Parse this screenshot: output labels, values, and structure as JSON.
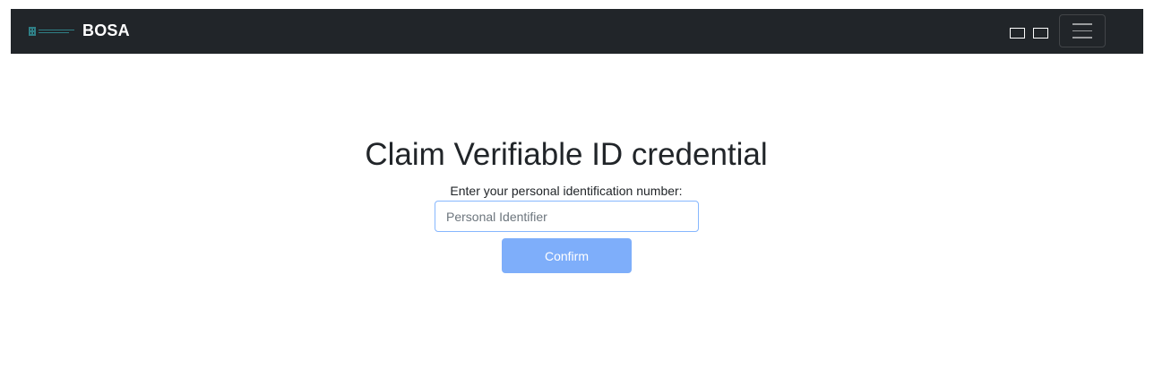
{
  "navbar": {
    "brand": "BOSA",
    "logo_icon": "bosa-logo",
    "icons": [
      "square-icon",
      "square-icon",
      "hamburger-menu-icon"
    ]
  },
  "main": {
    "title": "Claim Verifiable ID credential",
    "prompt_label": "Enter your personal identification number:",
    "input_value": "",
    "input_placeholder": "Personal Identifier",
    "confirm_label": "Confirm"
  },
  "colors": {
    "navbar_bg": "#212529",
    "confirm_bg": "#7eaefa",
    "input_border": "#86b7fe"
  }
}
